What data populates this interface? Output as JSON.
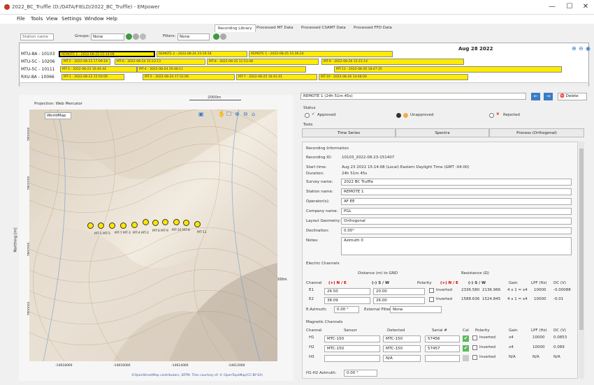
{
  "window": {
    "title": "2022_BC_Truffle (D:/DATA/FIELD/2022_BC_Truffle) - EMpower",
    "minimize": "—",
    "maximize": "☐",
    "close": "✕"
  },
  "menu": [
    "File",
    "Tools",
    "View",
    "Settings",
    "Window",
    "Help"
  ],
  "tabs": [
    "Recording Library",
    "Processed MT Data",
    "Processed CSAMT Data",
    "Processed FFD Data"
  ],
  "filter": {
    "station_placeholder": "Station name",
    "groups_label": "Groups:",
    "groups_value": "None",
    "filters_label": "Filters:",
    "filters_value": "None"
  },
  "timeline": {
    "date": "Aug 28 2022",
    "stations": [
      "MTU-8A - 10103",
      "MTU-5C - 10206",
      "MTU-5C - 10111",
      "RXU-8A - 10066"
    ],
    "bars": [
      {
        "row": 0,
        "label": "REMOTE 1 - 2022-08-23 15:14:08",
        "sel": true
      },
      {
        "row": 0,
        "label": "REMOTE 2 - 2022-08-24 23:19:18",
        "sel": false
      },
      {
        "row": 0,
        "label": "REMOTE 1 - 2022-08-25 15:36:24",
        "sel": false
      },
      {
        "row": 1,
        "label": "MT-2 - 2022-08-23 17:09:18",
        "sel": false
      },
      {
        "row": 1,
        "label": "MT-6 - 2022-08-24 15:23:13",
        "sel": false
      },
      {
        "row": 1,
        "label": "MT-8 - 2022-08-25 11:53:48",
        "sel": false
      },
      {
        "row": 1,
        "label": "MT-9 - 2022-08-26 15:21:14",
        "sel": false
      },
      {
        "row": 2,
        "label": "MT-3 - 2022-08-23 16:44:44",
        "sel": false
      },
      {
        "row": 2,
        "label": "MT-4 - 2022-08-24 20:48:11",
        "sel": false
      },
      {
        "row": 2,
        "label": "MT-11 - 2022-08-26 18:47:35",
        "sel": false
      },
      {
        "row": 3,
        "label": "MT-1 - 2022-08-23 15:50:09",
        "sel": false
      },
      {
        "row": 3,
        "label": "MT-5 - 2022-08-24 17:31:06",
        "sel": false
      },
      {
        "row": 3,
        "label": "MT-7 - 2022-08-25 16:41:41",
        "sel": false
      },
      {
        "row": 3,
        "label": "MT-10 - 2022-08-26 14:48:00",
        "sel": false
      }
    ]
  },
  "map": {
    "projection": "Projection: Web Mercator",
    "basemap": "WorldMap",
    "scale_top": "2000m",
    "scale_side": "2000m",
    "ylabel": "Northing [m]",
    "yticks": [
      "7800000",
      "7801000",
      "7800500",
      "7800000"
    ],
    "xticks": [
      "-14618000",
      "-14616000",
      "-14614000",
      "-14612000"
    ],
    "attribution": "©OpenStreetMap contributors, SRTM. Tiles courtesy of: © OpenTopoMap(CC-BY-SA)",
    "points": [
      "MT-1",
      "MT-5",
      "MT-7",
      "MT-3",
      "MT-2",
      "MT-4",
      "MT-9",
      "MT-6",
      "MT-8",
      "MT-10",
      "MT-11"
    ],
    "point_labels": [
      "MT-1 MT-5",
      "MT-7 MT-3",
      "MT-4 MT-2",
      "MT-6 MT-9",
      "MT-10 MT-8",
      "MT-11"
    ]
  },
  "recording": {
    "header": "REMOTE 1 (24h 51m 45s)",
    "delete": "Delete",
    "status_label": "Status",
    "approved": "Approved",
    "unapproved": "Unapproved",
    "rejected": "Rejected",
    "tools_label": "Tools",
    "tools": [
      "Time Series",
      "Spectra",
      "Process (Orthogonal)"
    ],
    "info_label": "Recording Information",
    "id_label": "Recording ID:",
    "id": "10103_2022-08-23-151407",
    "start_label": "Start time:",
    "start": "Aug 23 2022 15:14:08 (Local) Eastern Daylight Time (GMT -04:00)",
    "dur_label": "Duration:",
    "dur": "24h 51m 45s",
    "survey_label": "Survey name:",
    "survey": "2022 BC Truffle",
    "station_label": "Station name:",
    "station": "REMOTE 1",
    "op_label": "Operator(s):",
    "op": "AF EE",
    "company_label": "Company name:",
    "company": "PGL",
    "layout_label": "Layout Geometry:",
    "layout": "Orthogonal",
    "decl_label": "Declination:",
    "decl": "0.00°",
    "notes_label": "Notes:",
    "notes": "Azimuth 0"
  },
  "electric": {
    "title": "Electric Channels",
    "dist_hdr": "Distance (m) to GND",
    "res_hdr": "Resistance (Ω)",
    "col_channel": "Channel",
    "col_plus": "(+) N / E",
    "col_minus": "(-) S / W",
    "col_polarity": "Polarity",
    "col_rplus": "(+) N / E",
    "col_rminus": "(-) S / W",
    "col_gain": "Gain",
    "col_lpf": "LPF (Hz)",
    "col_dc": "DC (V)",
    "rows": [
      {
        "ch": "E1",
        "plus": "26.50",
        "minus": "20.00",
        "pol": "Inverted",
        "rp": "2336.580",
        "rm": "2136.966",
        "gain": "4 x 1 = x4",
        "lpf": "10000",
        "dc": "-0.00088"
      },
      {
        "ch": "E2",
        "plus": "38.09",
        "minus": "26.00",
        "pol": "Inverted",
        "rp": "1588.636",
        "rm": "1524.845",
        "gain": "4 x 1 = x4",
        "lpf": "10000",
        "dc": "-0.01"
      }
    ],
    "azimuth_label": "E-Azimuth:",
    "azimuth": "0.00 °",
    "filter_label": "External Filter:",
    "filter": "None"
  },
  "magnetic": {
    "title": "Magnetic Channels",
    "col_channel": "Channel",
    "col_sensor": "Sensor",
    "col_detected": "Detected",
    "col_serial": "Serial #",
    "col_cal": "Cal",
    "col_polarity": "Polarity",
    "col_gain": "Gain",
    "col_lpf": "LPF (Hz)",
    "col_dc": "DC (V)",
    "rows": [
      {
        "ch": "H1",
        "sensor": "MTC-150",
        "det": "MTC-150",
        "serial": "57456",
        "pol": "Inverted",
        "gain": "x4",
        "lpf": "10000",
        "dc": "0.0853"
      },
      {
        "ch": "H2",
        "sensor": "MTC-150",
        "det": "MTC-150",
        "serial": "57457",
        "pol": "Inverted",
        "gain": "x4",
        "lpf": "10000",
        "dc": "0.089"
      },
      {
        "ch": "H3",
        "sensor": "",
        "det": "N/A",
        "serial": "",
        "pol": "Inverted",
        "gain": "N/A",
        "lpf": "N/A",
        "dc": "N/A"
      }
    ],
    "azimuth_label": "H1-H2 Azimuth:",
    "azimuth": "0.00 °"
  },
  "colors": {
    "bar": "#ffeb00",
    "approved": "#5cb85c",
    "unapproved": "#f0ad4e",
    "rejected": "#d9534f"
  }
}
